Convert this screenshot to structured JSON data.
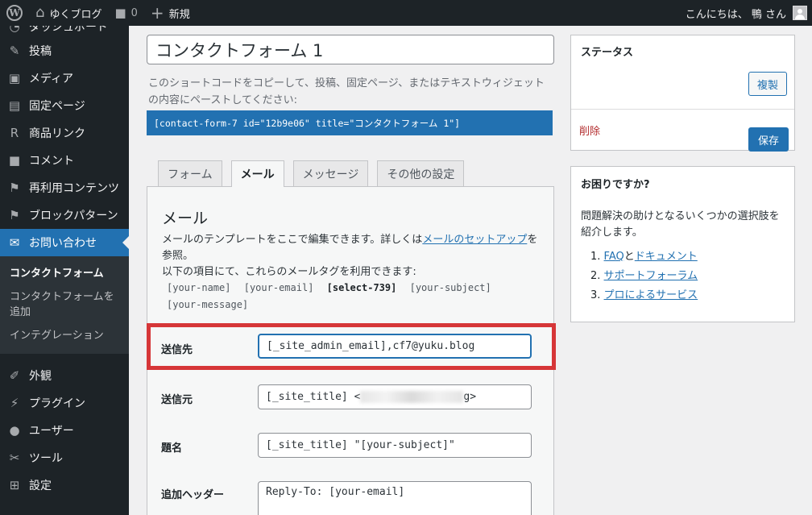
{
  "adminbar": {
    "site_name": "ゆくブログ",
    "comments_count": "0",
    "new_label": "新規",
    "greeting": "こんにちは、 鴨 さん"
  },
  "sidebar": {
    "partial_item": "ダッシュボード",
    "items": [
      {
        "label": "投稿",
        "icon": "pin-icon"
      },
      {
        "label": "メディア",
        "icon": "media-icon"
      },
      {
        "label": "固定ページ",
        "icon": "pages-icon"
      },
      {
        "label": "商品リンク",
        "icon": "r-icon"
      },
      {
        "label": "コメント",
        "icon": "comment-icon"
      },
      {
        "label": "再利用コンテンツ",
        "icon": "flag-icon"
      },
      {
        "label": "ブロックパターン",
        "icon": "flag-icon"
      },
      {
        "label": "お問い合わせ",
        "icon": "envelope-icon"
      }
    ],
    "submenu": [
      "コンタクトフォーム",
      "コンタクトフォームを追加",
      "インテグレーション"
    ],
    "items_after": [
      {
        "label": "外観",
        "icon": "brush-icon"
      },
      {
        "label": "プラグイン",
        "icon": "plugin-icon"
      },
      {
        "label": "ユーザー",
        "icon": "user-icon"
      },
      {
        "label": "ツール",
        "icon": "wrench-icon"
      },
      {
        "label": "設定",
        "icon": "settings-icon"
      }
    ]
  },
  "form": {
    "title": "コンタクトフォーム 1",
    "shortcode_desc": "このショートコードをコピーして、投稿、固定ページ、またはテキストウィジェットの内容にペーストしてください:",
    "shortcode": "[contact-form-7 id=\"12b9e06\" title=\"コンタクトフォーム 1\"]"
  },
  "tabs": [
    "フォーム",
    "メール",
    "メッセージ",
    "その他の設定"
  ],
  "mail": {
    "heading": "メール",
    "desc_before": "メールのテンプレートをここで編集できます。詳しくは",
    "desc_link": "メールのセットアップ",
    "desc_after": "を参照。",
    "desc_line2": "以下の項目にて、これらのメールタグを利用できます:",
    "tags": [
      "[your-name]",
      "[your-email]",
      "[select-739]",
      "[your-subject]",
      "[your-message]"
    ],
    "fields": [
      {
        "label": "送信先",
        "value": "[_site_admin_email],cf7@yuku.blog"
      },
      {
        "label": "送信元",
        "value_prefix": "[_site_title] <",
        "value_suffix": "g>"
      },
      {
        "label": "題名",
        "value": "[_site_title] \"[your-subject]\""
      },
      {
        "label": "追加ヘッダー",
        "value": "Reply-To: [your-email]"
      }
    ]
  },
  "status_box": {
    "title": "ステータス",
    "duplicate": "複製",
    "delete": "削除",
    "save": "保存"
  },
  "help_box": {
    "title": "お困りですか?",
    "text": "問題解決の助けとなるいくつかの選択肢を紹介します。",
    "items": [
      {
        "num": "1.",
        "link1": "FAQ",
        "sep": "と",
        "link2": "ドキュメント"
      },
      {
        "num": "2.",
        "link1": "サポートフォーラム"
      },
      {
        "num": "3.",
        "link1": "プロによるサービス"
      }
    ]
  },
  "colors": {
    "accent": "#2271b1",
    "highlight": "#d63638",
    "admin_dark": "#1d2327"
  }
}
